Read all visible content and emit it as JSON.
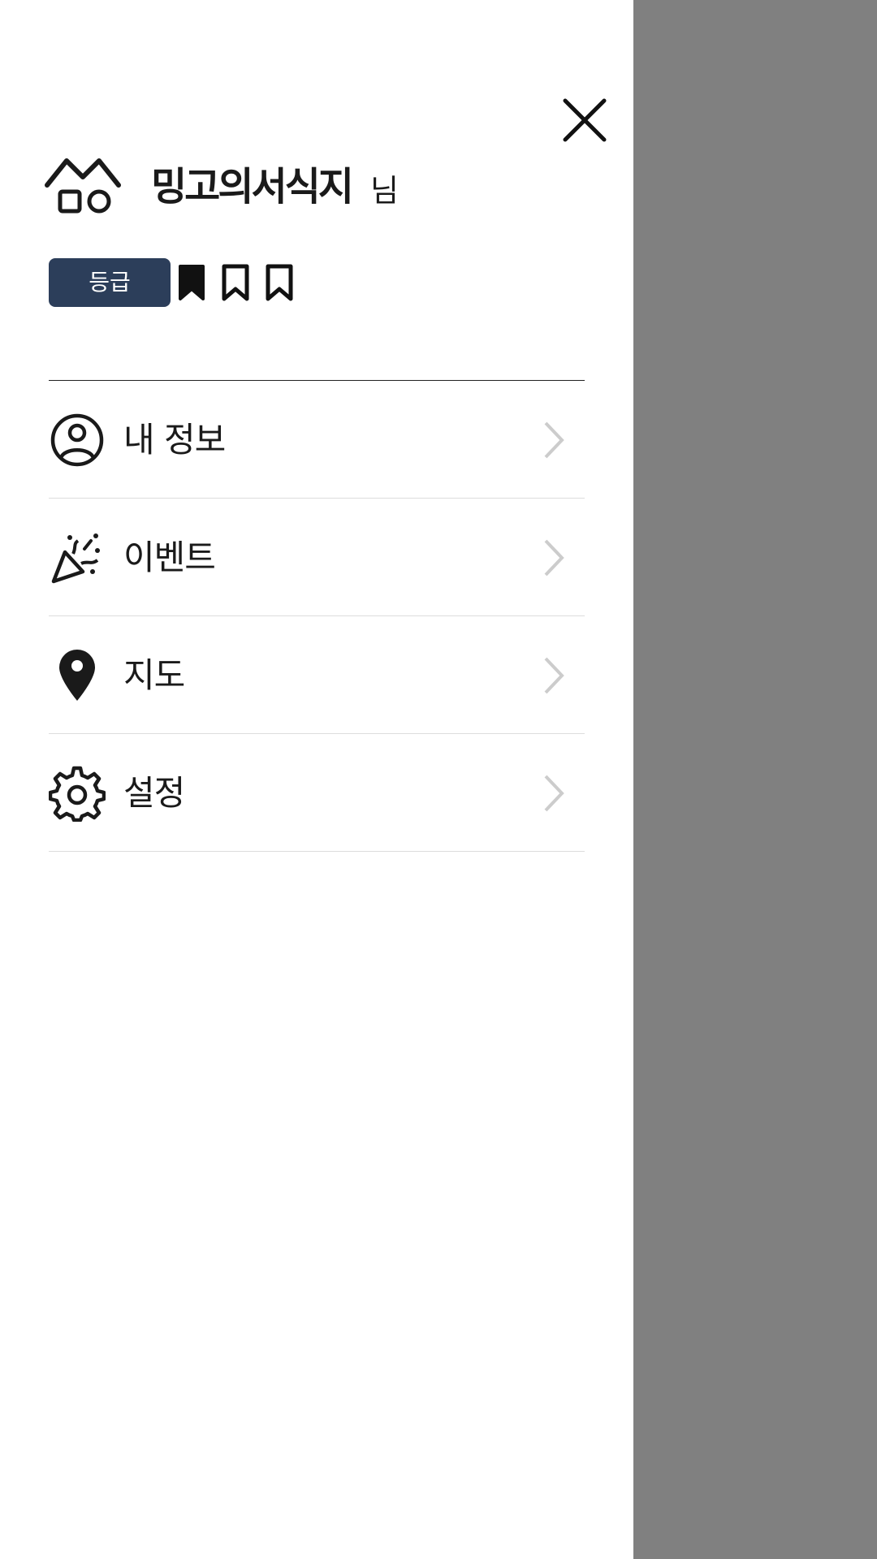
{
  "header": {
    "user_name": "밍고의서식지",
    "user_suffix": "님",
    "grade_label": "등급",
    "bookmarks": [
      "bookmark-filled-icon",
      "bookmark-outline-icon",
      "bookmark-outline-icon"
    ]
  },
  "menu": {
    "items": [
      {
        "label": "내 정보",
        "icon": "user-circle-icon"
      },
      {
        "label": "이벤트",
        "icon": "party-popper-icon"
      },
      {
        "label": "지도",
        "icon": "map-pin-icon"
      },
      {
        "label": "설정",
        "icon": "gear-icon"
      }
    ]
  },
  "colors": {
    "badge_bg": "#2c3e5a",
    "overlay": "#808080",
    "divider": "#dddddd",
    "chevron": "#cccccc"
  }
}
